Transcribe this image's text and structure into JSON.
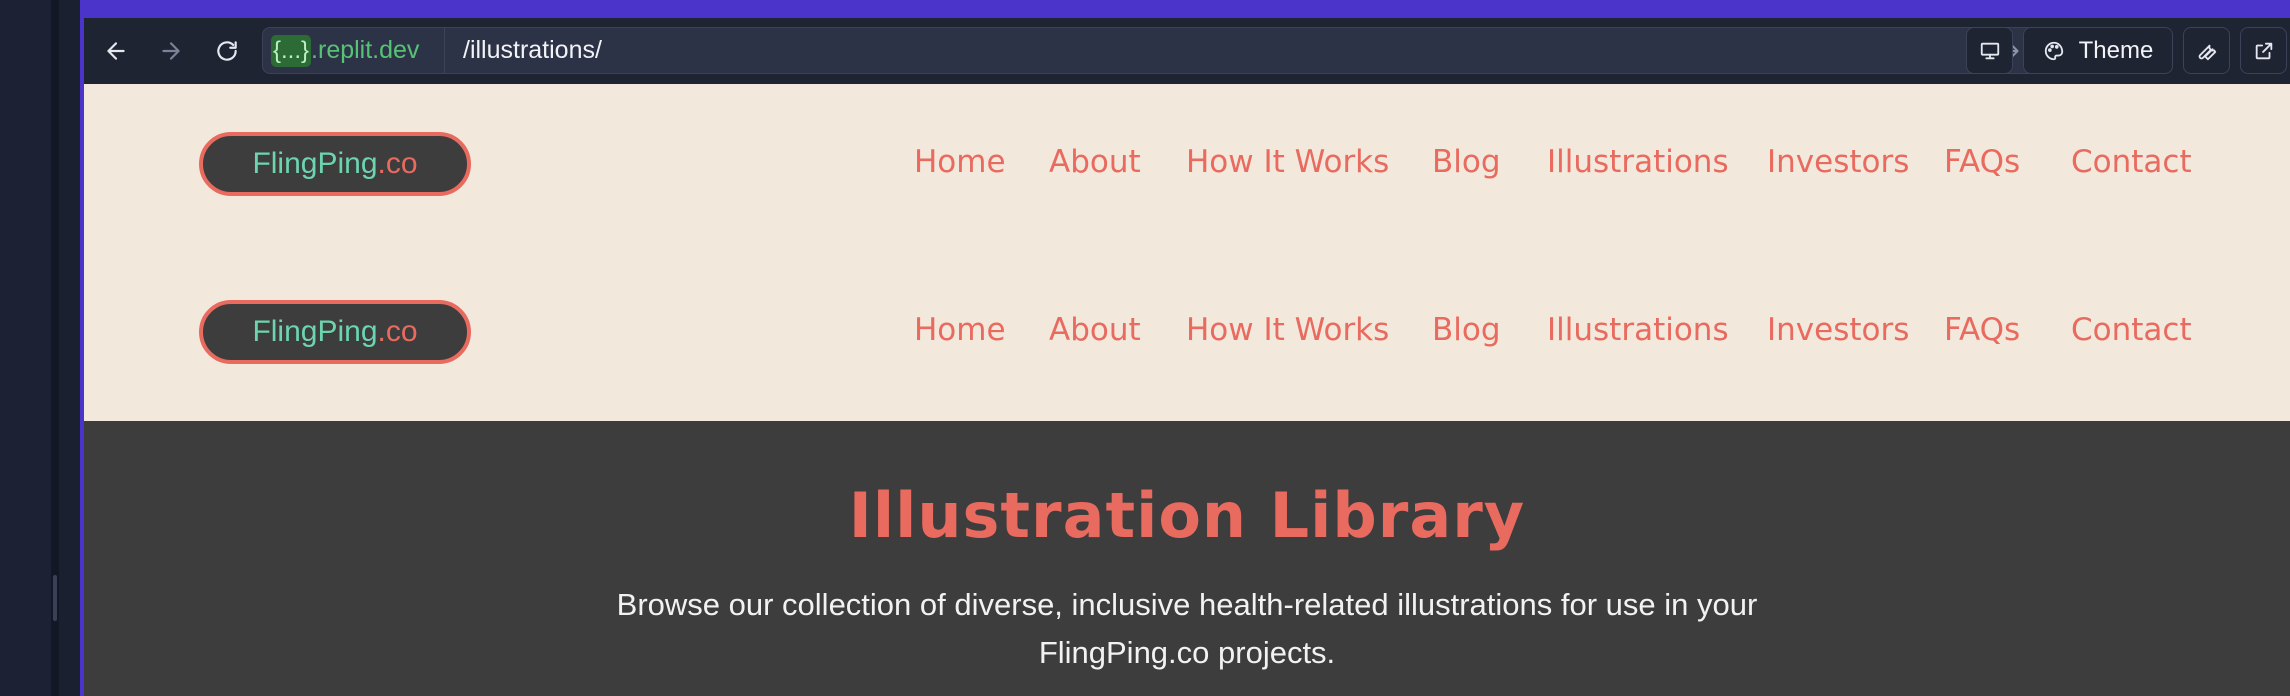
{
  "browser": {
    "url_host_braces": "{...}",
    "url_host_suffix": ".replit.dev",
    "url_path": "/illustrations/",
    "theme_label": "Theme"
  },
  "site": {
    "logo_main": "FlingPing",
    "logo_tld": ".co",
    "nav": [
      "Home",
      "About",
      "How It Works",
      "Blog",
      "Illustrations",
      "Investors",
      "FAQs",
      "Contact"
    ]
  },
  "hero": {
    "title": "Illustration Library",
    "description_line1": "Browse our collection of diverse, inclusive health-related illustrations for use in your",
    "description_line2": "FlingPing.co projects."
  },
  "colors": {
    "accent": "#e96a5e",
    "teal": "#6cd5b0",
    "cream": "#f3e8dc",
    "dark": "#3d3d3d",
    "frame": "#4a34c9"
  },
  "icons": [
    "back-arrow-icon",
    "forward-arrow-icon",
    "reload-icon",
    "go-arrow-icon",
    "monitor-icon",
    "palette-icon",
    "wrench-icon",
    "external-link-icon"
  ]
}
